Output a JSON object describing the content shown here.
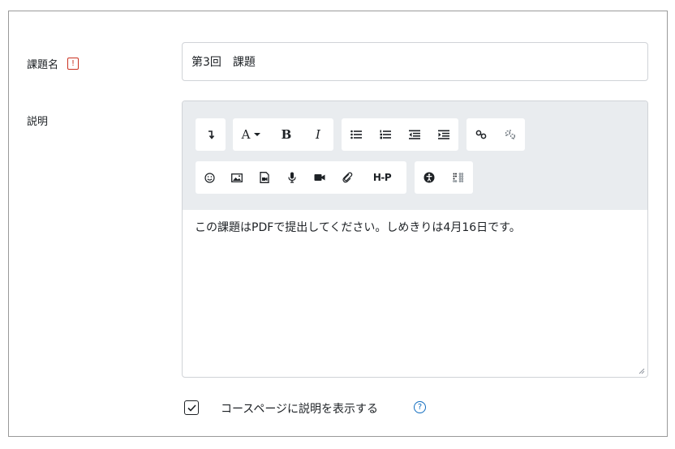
{
  "fields": {
    "title_label": "課題名",
    "required_badge": "!",
    "title_value": "第3回　課題",
    "description_label": "説明"
  },
  "toolbar": {
    "row1": [
      "collapse-icon",
      "font-color-icon",
      "bold-icon",
      "italic-icon",
      "bullet-list-icon",
      "numbered-list-icon",
      "outdent-icon",
      "indent-icon",
      "link-icon",
      "unlink-icon"
    ],
    "row2": [
      "emoji-icon",
      "image-icon",
      "media-file-icon",
      "record-audio-icon",
      "record-video-icon",
      "manage-files-icon",
      "h5p-icon",
      "accessibility-checker-icon",
      "screenreader-helper-icon"
    ],
    "font_letter": "A",
    "bold_letter": "B",
    "italic_letter": "I",
    "h5p_text": "H-P"
  },
  "editor": {
    "content": "この課題はPDFで提出してください。しめきりは4月16日です。"
  },
  "options": {
    "show_description_label": "コースページに説明を表示する",
    "show_description_checked": true,
    "help_symbol": "?"
  },
  "colors": {
    "accent": "#0f6cbf",
    "required": "#ca3120",
    "toolbar_bg": "#e9ecef",
    "border": "#d0d3d7"
  }
}
